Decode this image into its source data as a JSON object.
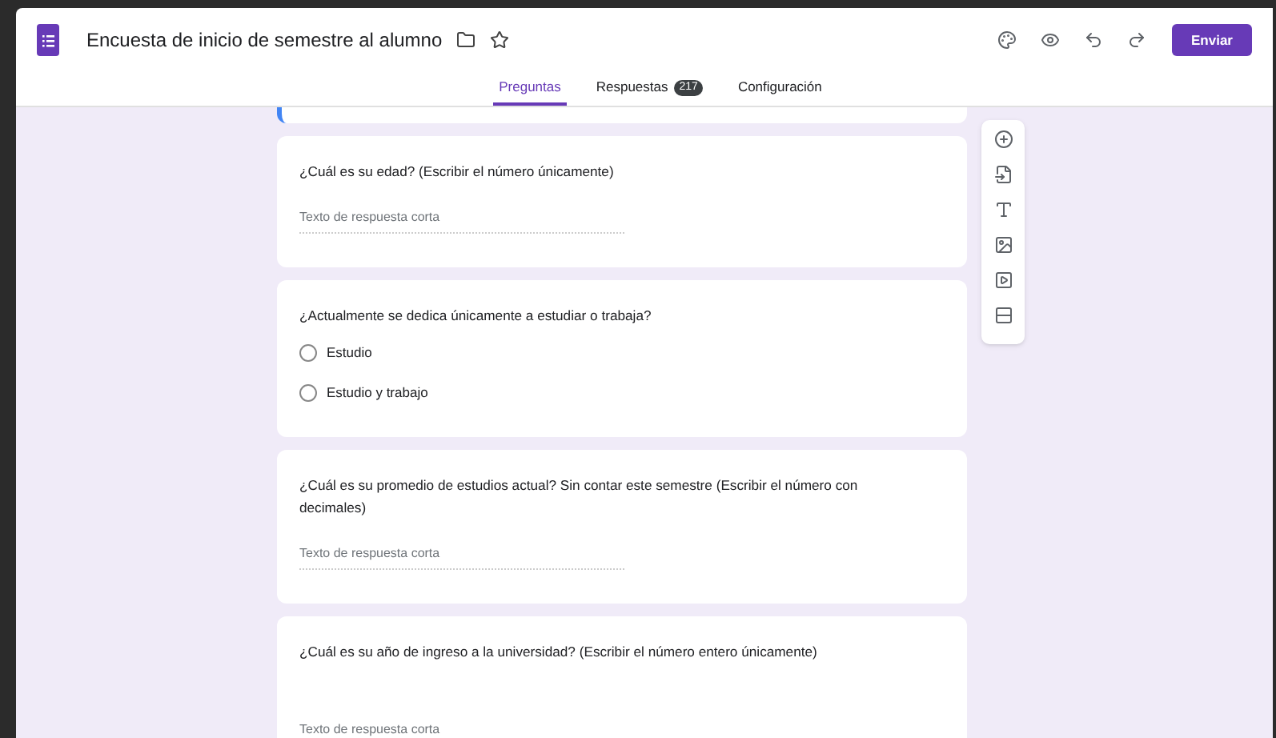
{
  "window": {
    "title": "Encuesta de inicio de semestre al alumno"
  },
  "send_button": "Enviar",
  "tabs": [
    {
      "label": "Preguntas",
      "selected": true
    },
    {
      "label": "Respuestas",
      "selected": false,
      "count": "217"
    },
    {
      "label": "Configuración",
      "selected": false
    }
  ],
  "questions": [
    {
      "kind": "short_answer",
      "title": "¿Cuál es su edad? (Escribir el número únicamente)",
      "placeholder": "Texto de respuesta corta"
    },
    {
      "kind": "multiple_choice",
      "title": "¿Actualmente se dedica únicamente a estudiar o trabaja?",
      "options": [
        {
          "label": "Estudio",
          "selected": false
        },
        {
          "label": "Estudio y trabajo",
          "selected": false
        }
      ]
    },
    {
      "kind": "short_answer",
      "title": "¿Cuál es su promedio de estudios actual? Sin contar este semestre (Escribir el número con decimales)",
      "placeholder": "Texto de respuesta corta"
    },
    {
      "kind": "short_answer_tall",
      "title": "¿Cuál es su año de ingreso a la universidad? (Escribir el número entero únicamente)",
      "placeholder": "Texto de respuesta corta"
    }
  ]
}
